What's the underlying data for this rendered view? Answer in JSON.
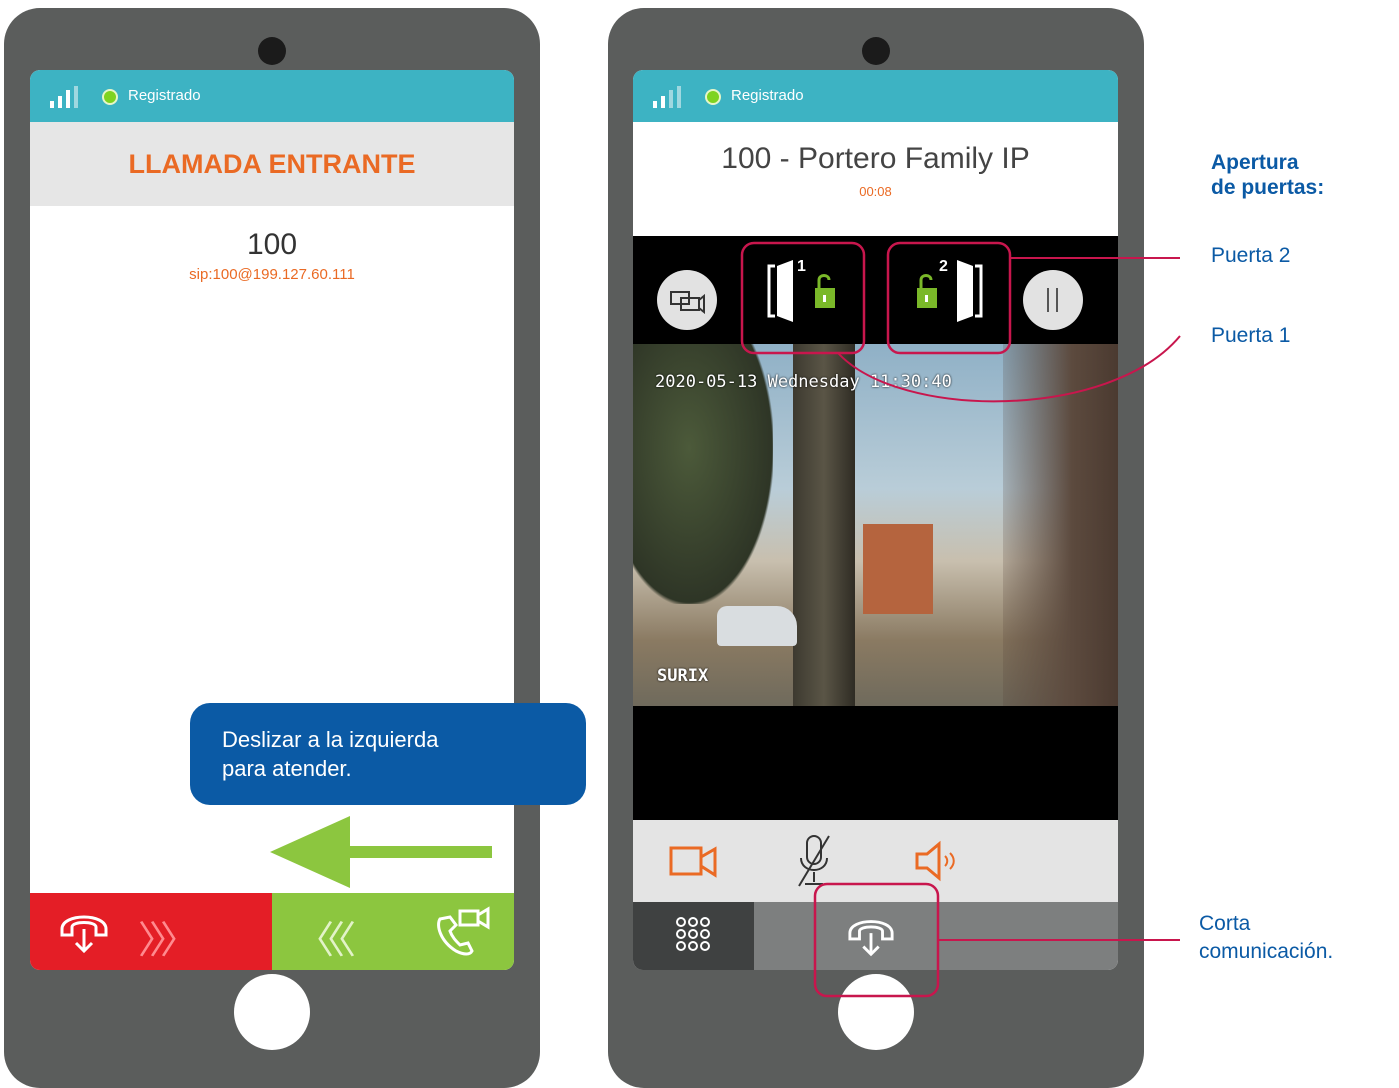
{
  "status": {
    "registered": "Registrado"
  },
  "left_phone": {
    "header": "LLAMADA ENTRANTE",
    "caller_number": "100",
    "caller_sip": "sip:100@199.127.60.111",
    "callout": {
      "line1": "Deslizar a la izquierda",
      "line2": "para atender."
    },
    "reject_chevrons": "〉〉〉",
    "accept_chevrons": "〈〈〈"
  },
  "right_phone": {
    "caller_title": "100 - Portero Family IP",
    "timer": "00:08",
    "door1_number": "1",
    "door2_number": "2",
    "video": {
      "timestamp": "2020-05-13 Wednesday 11:30:40",
      "brand": "SURIX"
    }
  },
  "annotations": {
    "title_line1": "Apertura",
    "title_line2": "de puertas:",
    "door2": "Puerta 2",
    "door1": "Puerta 1",
    "hangup_line1": "Corta",
    "hangup_line2": "comunicación."
  },
  "colors": {
    "teal": "#3db3c3",
    "orange": "#ea6a24",
    "red": "#e41e26",
    "green": "#8cc63f",
    "blue": "#0b5aa5",
    "magenta": "#c8164d",
    "lock_green": "#7ab829",
    "phone_body": "#5b5d5c"
  },
  "icons": [
    "signal-icon",
    "hangup-icon",
    "video-call-icon",
    "switch-camera-icon",
    "door-1-unlock-icon",
    "door-2-unlock-icon",
    "pause-icon",
    "video-icon",
    "mic-muted-icon",
    "speaker-icon",
    "keypad-icon"
  ]
}
